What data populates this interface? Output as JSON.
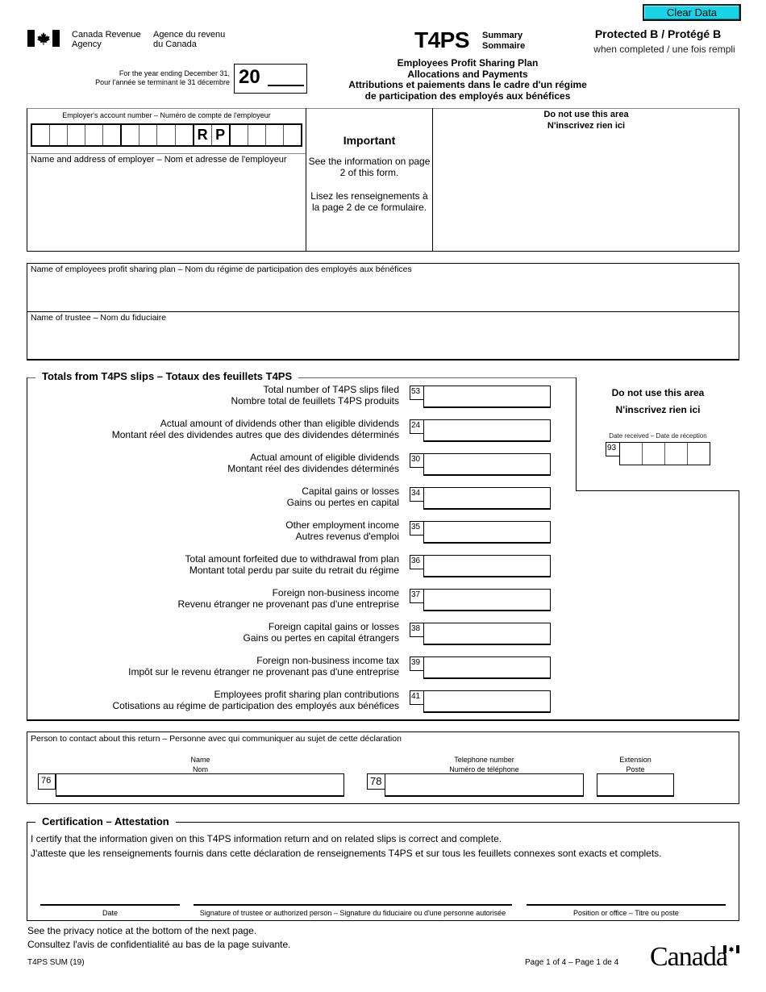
{
  "header": {
    "clear_button": "Clear Data",
    "agency_en": [
      "Canada Revenue",
      "Agency"
    ],
    "agency_fr": [
      "Agence du revenu",
      "du Canada"
    ],
    "form_name": "T4PS",
    "summary_en": "Summary",
    "summary_fr": "Sommaire",
    "protected": "Protected B / Protégé B",
    "when_completed": "when completed / une fois rempli",
    "year_label_en": "For the year ending December 31,",
    "year_label_fr": "Pour l'année se terminant le 31 décembre",
    "year_prefix": "20",
    "year_value": "",
    "subtitle": [
      "Employees Profit Sharing Plan",
      "Allocations and Payments",
      "Attributions et paiements dans le cadre d'un régime",
      "de participation des employés aux bénéfices"
    ]
  },
  "employer": {
    "account_label": "Employer's account number – Numéro de compte de l'employeur",
    "account_cells": [
      "",
      "",
      "",
      "",
      "",
      "",
      "",
      "",
      "",
      "R",
      "P",
      "",
      "",
      "",
      ""
    ],
    "name_address_label": "Name and address of employer – Nom et adresse de l'employeur",
    "name_address_value": ""
  },
  "important": {
    "title": "Important",
    "en": "See the information on page 2 of this form.",
    "fr": "Lisez les renseignements à la page 2 de ce formulaire."
  },
  "do_not_use_top": {
    "en": "Do not use this area",
    "fr": "N'inscrivez rien ici"
  },
  "plan": {
    "plan_name_label": "Name of employees profit sharing plan – Nom du régime de participation des employés aux bénéfices",
    "plan_name_value": "",
    "trustee_label": "Name of trustee – Nom du fiduciaire",
    "trustee_value": ""
  },
  "totals": {
    "title": "Totals from T4PS slips – Totaux des feuillets T4PS",
    "items": [
      {
        "code": "53",
        "en": "Total number of T4PS slips filed",
        "fr": "Nombre total de feuillets T4PS produits",
        "value": ""
      },
      {
        "code": "24",
        "en": "Actual amount of dividends other than eligible dividends",
        "fr": "Montant réel des dividendes autres que des dividendes déterminés",
        "value": ""
      },
      {
        "code": "30",
        "en": "Actual amount of eligible dividends",
        "fr": "Montant réel des dividendes déterminés",
        "value": ""
      },
      {
        "code": "34",
        "en": "Capital gains or losses",
        "fr": "Gains ou pertes en capital",
        "value": ""
      },
      {
        "code": "35",
        "en": "Other employment income",
        "fr": "Autres revenus d'emploi",
        "value": ""
      },
      {
        "code": "36",
        "en": "Total amount forfeited due to withdrawal from plan",
        "fr": "Montant total perdu par suite du retrait du régime",
        "value": ""
      },
      {
        "code": "37",
        "en": "Foreign non-business income",
        "fr": "Revenu étranger ne provenant pas d'une entreprise",
        "value": ""
      },
      {
        "code": "38",
        "en": "Foreign capital gains or losses",
        "fr": "Gains ou pertes en capital étrangers",
        "value": ""
      },
      {
        "code": "39",
        "en": "Foreign non-business income tax",
        "fr": "Impôt sur le revenu étranger ne provenant pas d'une entreprise",
        "value": ""
      },
      {
        "code": "41",
        "en": "Employees profit sharing plan contributions",
        "fr": "Cotisations au régime de participation des employés aux bénéfices",
        "value": ""
      }
    ],
    "do_not_use": {
      "en": "Do not use this area",
      "fr": "N'inscrivez rien ici",
      "date_label": "Date received – Date de réception",
      "date_code": "93"
    }
  },
  "contact": {
    "label": "Person to contact about this return – Personne avec qui communiquer au sujet de cette déclaration",
    "name_label_en": "Name",
    "name_label_fr": "Nom",
    "name_code": "76",
    "name_value": "",
    "phone_label_en": "Telephone number",
    "phone_label_fr": "Numéro de téléphone",
    "phone_code": "78",
    "phone_value": "",
    "ext_label_en": "Extension",
    "ext_label_fr": "Poste",
    "ext_value": ""
  },
  "certification": {
    "title": "Certification – Attestation",
    "en": "I certify that the information given on this T4PS information return and on related slips is correct and complete.",
    "fr": "J'atteste que les renseignements fournis dans cette déclaration de renseignements T4PS et sur tous les feuillets connexes sont exacts et complets.",
    "date_label": "Date",
    "signature_label": "Signature of trustee or authorized person – Signature du fiduciaire ou d'une personne autorisée",
    "position_label": "Position or office – Titre ou poste"
  },
  "footer": {
    "privacy_en": "See the privacy notice at the bottom of the next page.",
    "privacy_fr": "Consultez l'avis de confidentialité au bas de la page suivante.",
    "form_code": "T4PS SUM (19)",
    "page": "Page 1 of 4 – Page 1 de 4",
    "wordmark": "Canada"
  },
  "colors": {
    "clear_button": "#19d4e6"
  }
}
